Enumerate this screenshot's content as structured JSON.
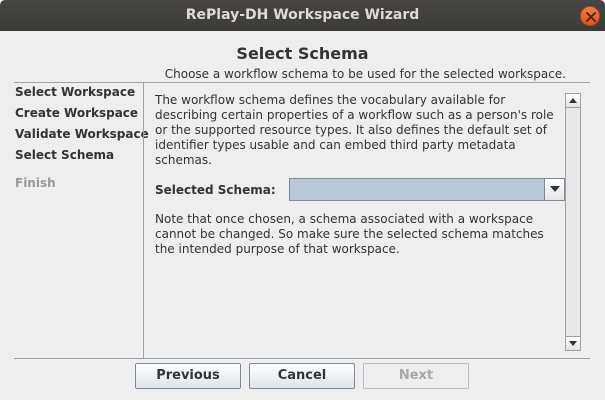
{
  "window": {
    "title": "RePlay-DH Workspace Wizard"
  },
  "header": {
    "title": "Select Schema",
    "subtitle": "Choose a workflow schema to be used for the selected workspace."
  },
  "steps": [
    {
      "label": "Select Workspace",
      "state": "done"
    },
    {
      "label": "Create Workspace",
      "state": "done"
    },
    {
      "label": "Validate Workspace",
      "state": "done"
    },
    {
      "label": "Select Schema",
      "state": "current"
    },
    {
      "label": "Finish",
      "state": "disabled"
    }
  ],
  "content": {
    "description": "The workflow schema defines the vocabulary available for describing certain properties of a workflow such as a person's role or the supported resource types. It also defines the default set of identifier types usable and can embed third party metadata schemas.",
    "schema_label": "Selected Schema:",
    "schema_value": "",
    "note": "Note that once chosen, a schema associated with a workspace cannot be changed. So make sure the selected schema matches the intended purpose of that workspace."
  },
  "buttons": {
    "previous": "Previous",
    "cancel": "Cancel",
    "next": "Next"
  },
  "colors": {
    "titlebar": "#3c3b37",
    "close": "#e0561f",
    "select_fill": "#b9c7d6",
    "disabled_text": "#a8a8a8"
  },
  "icons": {
    "close": "close-icon",
    "dropdown": "chevron-down-icon",
    "scroll_up": "arrow-up-icon",
    "scroll_down": "arrow-down-icon"
  }
}
